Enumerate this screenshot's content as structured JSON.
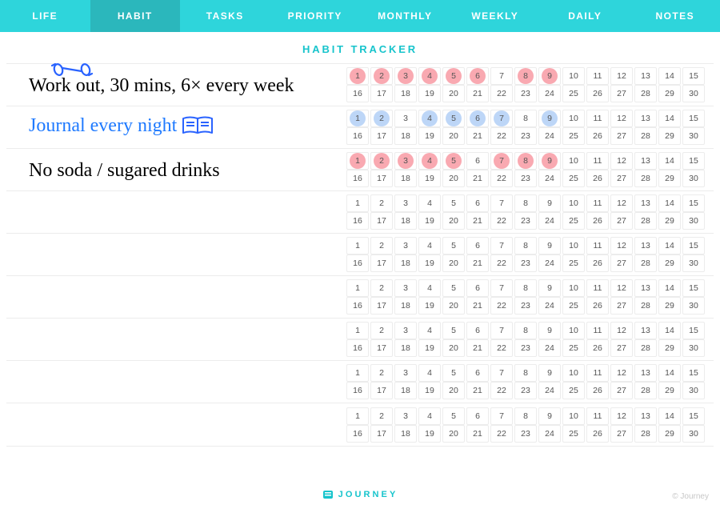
{
  "tabs": [
    {
      "label": "LIFE",
      "active": false
    },
    {
      "label": "HABIT",
      "active": true
    },
    {
      "label": "TASKS",
      "active": false
    },
    {
      "label": "PRIORITY",
      "active": false
    },
    {
      "label": "MONTHLY",
      "active": false
    },
    {
      "label": "WEEKLY",
      "active": false
    },
    {
      "label": "DAILY",
      "active": false
    },
    {
      "label": "NOTES",
      "active": false
    }
  ],
  "title": "HABIT TRACKER",
  "days_per_row": 30,
  "rows": [
    {
      "label": "Work out, 30 mins, 6× every week",
      "style": "black",
      "icon": "dumbbell-icon",
      "marked": [
        1,
        2,
        3,
        4,
        5,
        6,
        8,
        9
      ],
      "mark_color": "pink"
    },
    {
      "label": "Journal every night",
      "style": "blue",
      "icon": "book-icon",
      "marked": [
        1,
        2,
        4,
        5,
        6,
        7,
        9
      ],
      "mark_color": "blue"
    },
    {
      "label": "No soda / sugared drinks",
      "style": "black",
      "icon": null,
      "marked": [
        1,
        2,
        3,
        4,
        5,
        7,
        8,
        9
      ],
      "mark_color": "pink"
    },
    {
      "label": "",
      "style": "black",
      "icon": null,
      "marked": [],
      "mark_color": ""
    },
    {
      "label": "",
      "style": "black",
      "icon": null,
      "marked": [],
      "mark_color": ""
    },
    {
      "label": "",
      "style": "black",
      "icon": null,
      "marked": [],
      "mark_color": ""
    },
    {
      "label": "",
      "style": "black",
      "icon": null,
      "marked": [],
      "mark_color": ""
    },
    {
      "label": "",
      "style": "black",
      "icon": null,
      "marked": [],
      "mark_color": ""
    },
    {
      "label": "",
      "style": "black",
      "icon": null,
      "marked": [],
      "mark_color": ""
    }
  ],
  "footer": {
    "brand": "JOURNEY",
    "copyright": "© Journey"
  },
  "colors": {
    "accent": "#2ed5db",
    "accent_dark": "#2bb7bc",
    "mark_pink": "#f89aa3",
    "mark_blue": "#b6d1f6"
  }
}
